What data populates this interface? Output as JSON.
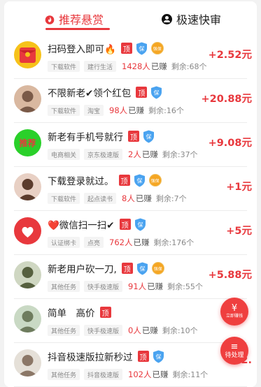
{
  "tabs": [
    {
      "label": "推荐悬赏",
      "active": true,
      "icon": "flame-icon"
    },
    {
      "label": "极速快审",
      "active": false,
      "icon": "person-icon"
    }
  ],
  "badges": {
    "ding": "顶",
    "bao": "保",
    "qiang": "强保"
  },
  "tasks": [
    {
      "title": "扫码登入即可🔥",
      "tags": [
        "下载软件",
        "建行生活"
      ],
      "count": "1428人",
      "done_label": "已赚",
      "remaining": "剩余:68个",
      "reward": "+2.52元",
      "avatar_icon": "red-envelope-icon",
      "bao": true,
      "qiang": true
    },
    {
      "title": "不限新老✔领个红包",
      "tags": [
        "下载软件",
        "淘宝"
      ],
      "count": "98人",
      "done_label": "已赚",
      "remaining": "剩余:16个",
      "reward": "+20.88元",
      "avatar_icon": "user-photo-icon",
      "bao": true,
      "qiang": false
    },
    {
      "title": "新老有手机号就行",
      "tags": [
        "电商相关",
        "京东极速版"
      ],
      "count": "2人",
      "done_label": "已赚",
      "remaining": "剩余:37个",
      "reward": "+9.08元",
      "avatar_icon": "recommend-icon",
      "avatar_text": "推荐",
      "bao": true,
      "qiang": false
    },
    {
      "title": "下载登录就过。",
      "tags": [
        "下载软件",
        "起点读书"
      ],
      "count": "8人",
      "done_label": "已赚",
      "remaining": "剩余:7个",
      "reward": "+1元",
      "avatar_icon": "user-photo-icon",
      "bao": true,
      "qiang": true
    },
    {
      "title": "❤️微信扫一扫✔",
      "tags": [
        "认证绑卡",
        "点亮"
      ],
      "count": "762人",
      "done_label": "已赚",
      "remaining": "剩余:176个",
      "reward": "+5元",
      "avatar_icon": "heart-hand-icon",
      "bao": true,
      "qiang": false
    },
    {
      "title": "新老用户砍一刀,",
      "tags": [
        "其他任务",
        "快手极速版"
      ],
      "count": "91人",
      "done_label": "已赚",
      "remaining": "剩余:55个",
      "reward": "+5.88元",
      "avatar_icon": "user-photo-icon",
      "bao": true,
      "qiang": true
    },
    {
      "title": "简单　高价",
      "tags": [
        "其他任务",
        "快手极速版"
      ],
      "count": "0人",
      "done_label": "已赚",
      "remaining": "剩余:10个",
      "reward": "",
      "avatar_icon": "user-photo-icon",
      "bao": false,
      "qiang": false
    },
    {
      "title": "抖音极速版拉新秒过",
      "tags": [
        "其他任务",
        "抖音极速版"
      ],
      "count": "102人",
      "done_label": "已赚",
      "remaining": "剩余:11个",
      "reward": "+2.",
      "avatar_icon": "user-photo-icon",
      "bao": true,
      "qiang": false
    }
  ],
  "fab_earn": {
    "icon": "¥",
    "label": "立即赚钱"
  },
  "fab_pending": {
    "icon": "≡",
    "label": "待处理"
  },
  "colors": {
    "accent": "#e8383d",
    "shield": "#4aa3f0",
    "gold": "#f5a623"
  }
}
